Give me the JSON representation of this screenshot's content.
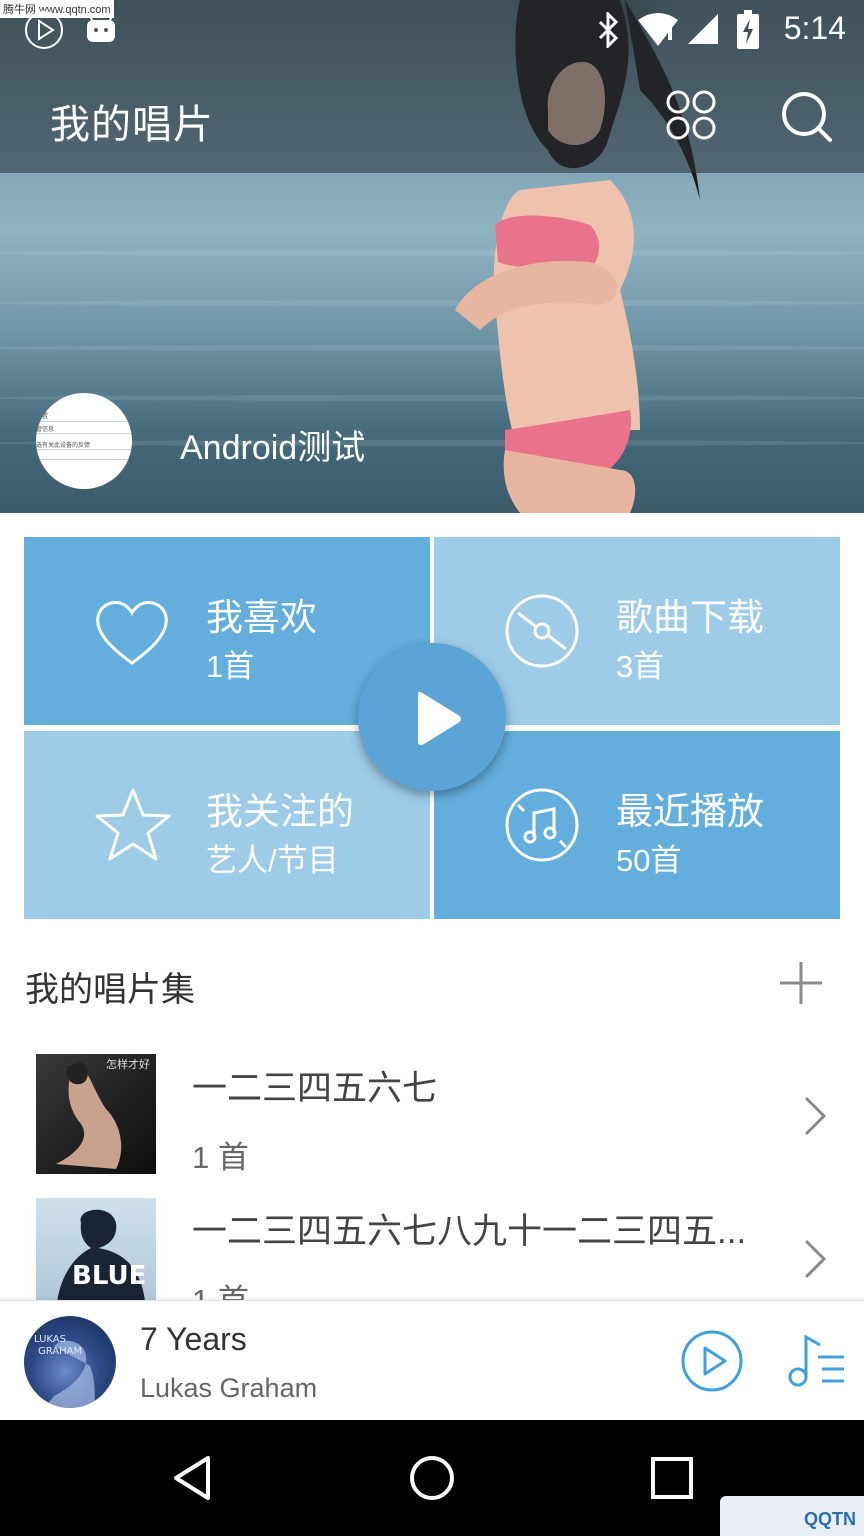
{
  "statusbar": {
    "time": "5:14",
    "watermark": "腾牛网 www.qqtn.com"
  },
  "header": {
    "title": "我的唱片"
  },
  "profile": {
    "username": "Android测试"
  },
  "tiles": [
    {
      "title": "我喜欢",
      "subtitle": "1首",
      "color": "#63aedc",
      "icon": "heart-icon"
    },
    {
      "title": "歌曲下载",
      "subtitle": "3首",
      "color": "#9dcbe8",
      "icon": "disc-icon"
    },
    {
      "title": "我关注的",
      "subtitle": "艺人/节目",
      "color": "#9dcbe8",
      "icon": "star-icon"
    },
    {
      "title": "最近播放",
      "subtitle": "50首",
      "color": "#63aedc",
      "icon": "music-note-icon"
    }
  ],
  "collections": {
    "title": "我的唱片集",
    "albums": [
      {
        "title": "一二三四五六七",
        "count": "1 首",
        "cover_text": "怎样才好"
      },
      {
        "title": "一二三四五六七八九十一二三四五...",
        "count": "1 首",
        "cover_text": "BLUE"
      }
    ]
  },
  "player": {
    "title": "7 Years",
    "artist": "Lukas Graham",
    "accent": "#3ea0dc"
  },
  "watermark_bottom": "QQTN"
}
